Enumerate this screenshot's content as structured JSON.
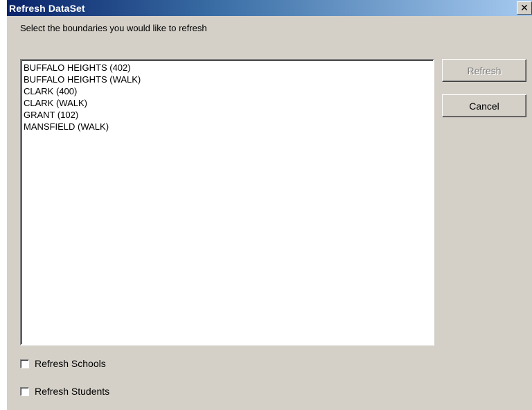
{
  "window": {
    "title": "Refresh DataSet",
    "close_glyph": "✕"
  },
  "prompt": "Select the boundaries you would like to refresh",
  "boundaries": [
    "BUFFALO HEIGHTS (402)",
    "BUFFALO HEIGHTS (WALK)",
    "CLARK (400)",
    "CLARK (WALK)",
    "GRANT (102)",
    "MANSFIELD (WALK)"
  ],
  "buttons": {
    "refresh": {
      "label": "Refresh",
      "enabled": false
    },
    "cancel": {
      "label": "Cancel",
      "enabled": true
    }
  },
  "options": {
    "refresh_schools": {
      "label": "Refresh Schools",
      "checked": false
    },
    "refresh_students": {
      "label": "Refresh Students",
      "checked": false
    }
  },
  "colors": {
    "title_gradient_start": "#0a246a",
    "title_gradient_end": "#a6caf0",
    "dialog_face": "#d4d0c8",
    "disabled_text": "#808080"
  }
}
